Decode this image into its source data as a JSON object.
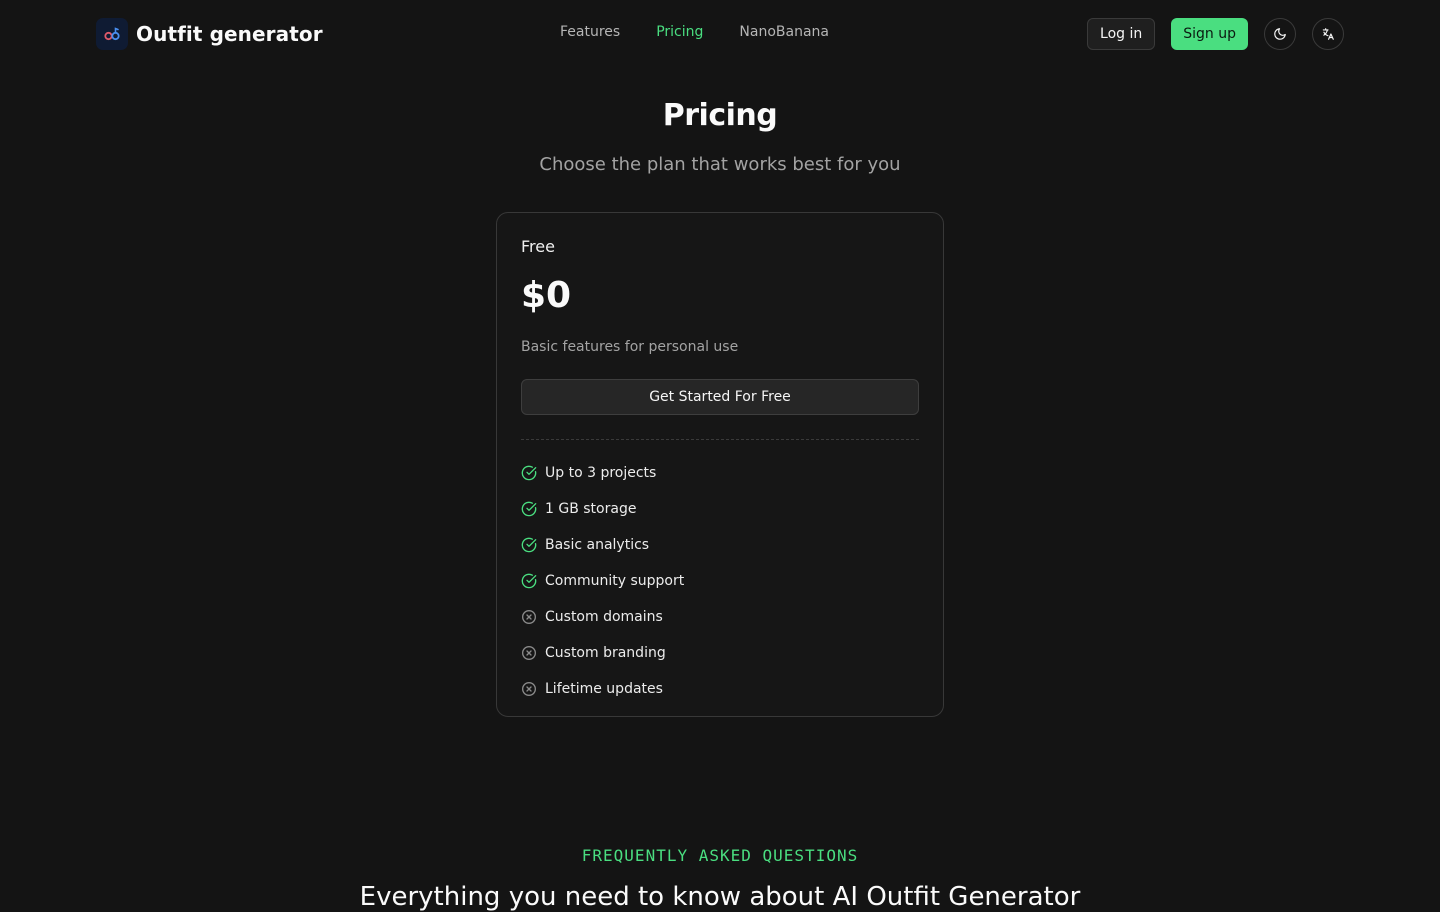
{
  "header": {
    "brand_name": "Outfit generator",
    "nav": [
      {
        "label": "Features",
        "active": false
      },
      {
        "label": "Pricing",
        "active": true
      },
      {
        "label": "NanoBanana",
        "active": false
      }
    ],
    "login_label": "Log in",
    "signup_label": "Sign up",
    "theme_icon": "moon-icon",
    "language_icon": "translate-icon"
  },
  "hero": {
    "title": "Pricing",
    "subtitle": "Choose the plan that works best for you"
  },
  "plan": {
    "name": "Free",
    "price": "$0",
    "description": "Basic features for personal use",
    "cta_label": "Get Started For Free",
    "features": [
      {
        "label": "Up to 3 projects",
        "included": true
      },
      {
        "label": "1 GB storage",
        "included": true
      },
      {
        "label": "Basic analytics",
        "included": true
      },
      {
        "label": "Community support",
        "included": true
      },
      {
        "label": "Custom domains",
        "included": false
      },
      {
        "label": "Custom branding",
        "included": false
      },
      {
        "label": "Lifetime updates",
        "included": false
      }
    ]
  },
  "faq": {
    "eyebrow": "FREQUENTLY ASKED QUESTIONS",
    "heading": "Everything you need to know about AI Outfit Generator"
  },
  "colors": {
    "background": "#141414",
    "accent": "#4ade80",
    "included_icon": "#4ade80",
    "excluded_icon": "#8a8a8a"
  }
}
